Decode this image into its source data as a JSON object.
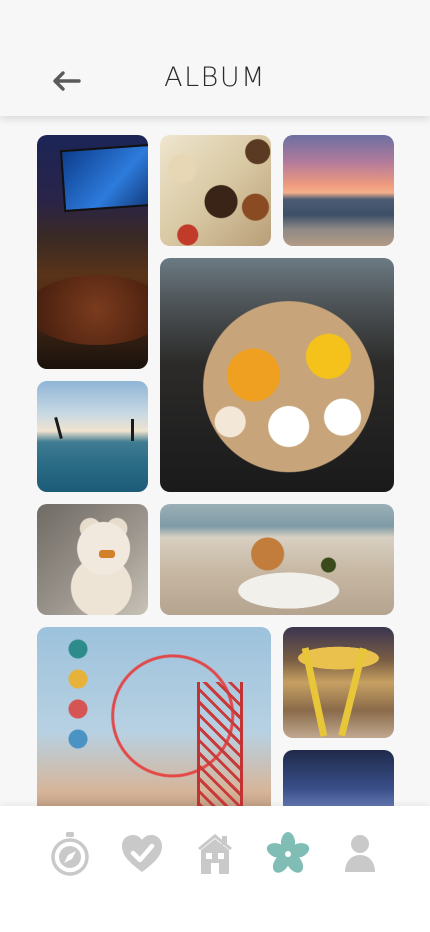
{
  "header": {
    "title": "ALBUM",
    "back_icon": "arrow-left-icon"
  },
  "album": {
    "photos": [
      {
        "id": "tv-pizza-night",
        "icon": "photo"
      },
      {
        "id": "snack-board",
        "icon": "photo"
      },
      {
        "id": "beach-sunset",
        "icon": "photo"
      },
      {
        "id": "flower-bouquet",
        "icon": "photo"
      },
      {
        "id": "beach-couple",
        "icon": "photo"
      },
      {
        "id": "teddy-bear",
        "icon": "photo"
      },
      {
        "id": "beach-picnic",
        "icon": "photo"
      },
      {
        "id": "ferris-wheel",
        "icon": "photo"
      },
      {
        "id": "carousel",
        "icon": "photo"
      },
      {
        "id": "fair-lights",
        "icon": "photo"
      }
    ]
  },
  "nav": {
    "items": [
      {
        "icon": "compass-icon",
        "active": false
      },
      {
        "icon": "heart-check-icon",
        "active": false
      },
      {
        "icon": "home-icon",
        "active": false
      },
      {
        "icon": "flower-icon",
        "active": true
      },
      {
        "icon": "person-icon",
        "active": false
      }
    ],
    "colors": {
      "inactive": "#c9c9c9",
      "active": "#7fbdb5"
    }
  }
}
